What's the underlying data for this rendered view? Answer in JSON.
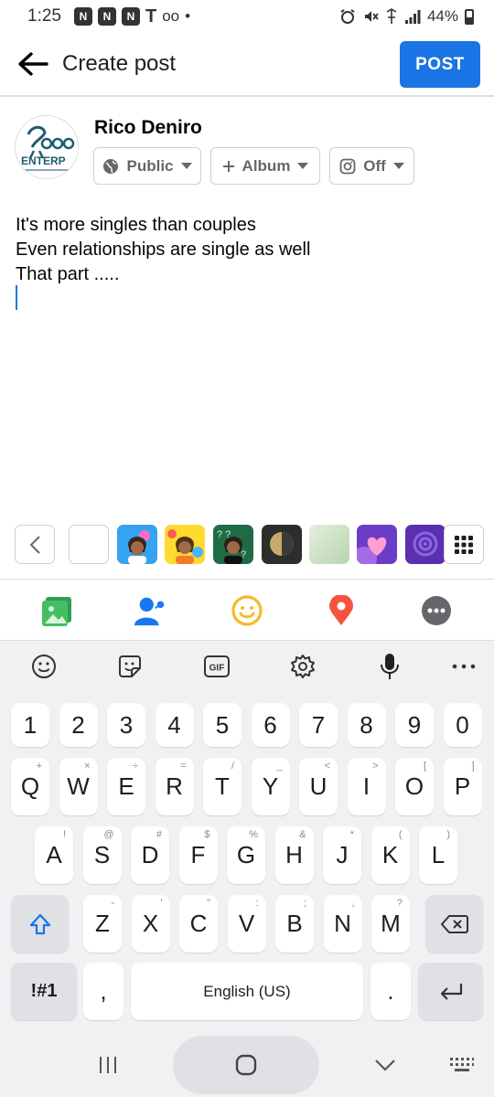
{
  "status_bar": {
    "time": "1:25",
    "notification_glyphs": [
      "N",
      "N",
      "N"
    ],
    "carrier_glyph": "T",
    "voicemail_glyph": "oo",
    "dot": "•",
    "battery_percent": "44%",
    "battery_level": 0.44
  },
  "header": {
    "title": "Create post",
    "post_label": "POST",
    "accent_color": "#1b74e4"
  },
  "author": {
    "name": "Rico Deniro",
    "avatar_logo_text": "ENTERP"
  },
  "audience": {
    "privacy_label": "Public",
    "album_label": "Album",
    "instagram_label": "Off"
  },
  "post": {
    "lines": [
      "It's more singles than couples",
      "Even relationships are single as well",
      "That part ....."
    ]
  },
  "backgrounds": {
    "swatches": [
      {
        "name": "plain-white",
        "color": "#ffffff"
      },
      {
        "name": "avatar-blue",
        "color": "#35a3f0"
      },
      {
        "name": "avatar-yellow",
        "color": "#ffd92e"
      },
      {
        "name": "avatar-green",
        "color": "#1f6b46"
      },
      {
        "name": "dark-gold",
        "color": "#2d2d2d"
      },
      {
        "name": "soft-green",
        "color": "#c9dfc2"
      },
      {
        "name": "purple-heart",
        "color": "#6b3cc8"
      },
      {
        "name": "purple-pattern",
        "color": "#5a2fb0"
      }
    ]
  },
  "composer_tools": [
    "photo-icon",
    "tag-people-icon",
    "feeling-icon",
    "check-in-icon",
    "more-icon"
  ],
  "keyboard": {
    "toolbar": [
      "emoji-icon",
      "sticker-icon",
      "gif-icon",
      "settings-icon",
      "microphone-icon",
      "more-icon"
    ],
    "gif_label": "GIF",
    "number_row": [
      "1",
      "2",
      "3",
      "4",
      "5",
      "6",
      "7",
      "8",
      "9",
      "0"
    ],
    "row1": [
      "Q",
      "W",
      "E",
      "R",
      "T",
      "Y",
      "U",
      "I",
      "O",
      "P"
    ],
    "row1_hints": [
      "+",
      "×",
      "÷",
      "=",
      "/",
      "_",
      "<",
      ">",
      "[",
      "]"
    ],
    "row2": [
      "A",
      "S",
      "D",
      "F",
      "G",
      "H",
      "J",
      "K",
      "L"
    ],
    "row2_hints": [
      "!",
      "@",
      "#",
      "$",
      "%",
      "&",
      "*",
      "(",
      ")"
    ],
    "row3": [
      "Z",
      "X",
      "C",
      "V",
      "B",
      "N",
      "M"
    ],
    "row3_hints": [
      "-",
      "'",
      "\"",
      ":",
      ";",
      ",",
      "?"
    ],
    "symbols_label": "!#1",
    "comma_label": ",",
    "space_label": "English (US)",
    "period_label": "."
  },
  "nav_bar": [
    "recent-apps-icon",
    "home-icon",
    "back-icon",
    "keyboard-switch-icon"
  ]
}
